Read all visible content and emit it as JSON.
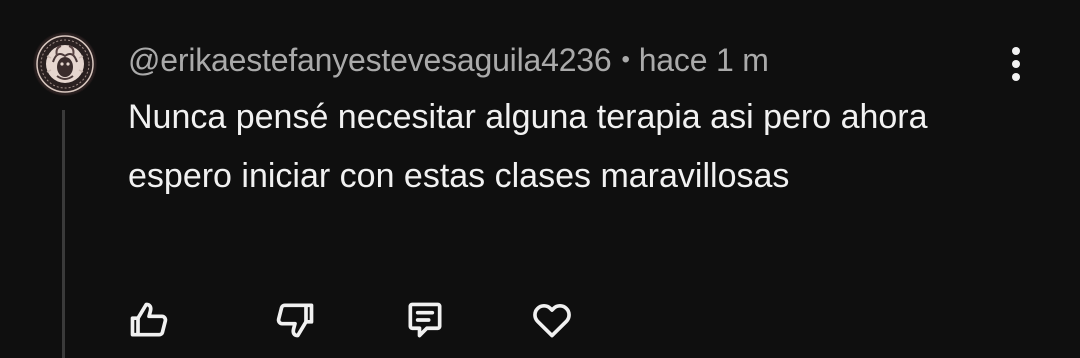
{
  "comment": {
    "author": "@erikaestefanyestevesaguila4236",
    "separator": "•",
    "time": "hace 1 m",
    "text": "Nunca pensé necesitar alguna terapia asi pero ahora espero iniciar con estas clases maravillosas"
  },
  "icons": {
    "avatar": "avatar-medallion-icon",
    "menu": "more-vert-icon",
    "like": "thumbs-up-icon",
    "dislike": "thumbs-down-icon",
    "reply": "reply-comment-icon",
    "heart": "heart-icon"
  },
  "colors": {
    "background": "#0f0f0f",
    "text_primary": "#f1f1f1",
    "text_secondary": "#aaaaaa",
    "thread_line": "#3a3a3a"
  }
}
